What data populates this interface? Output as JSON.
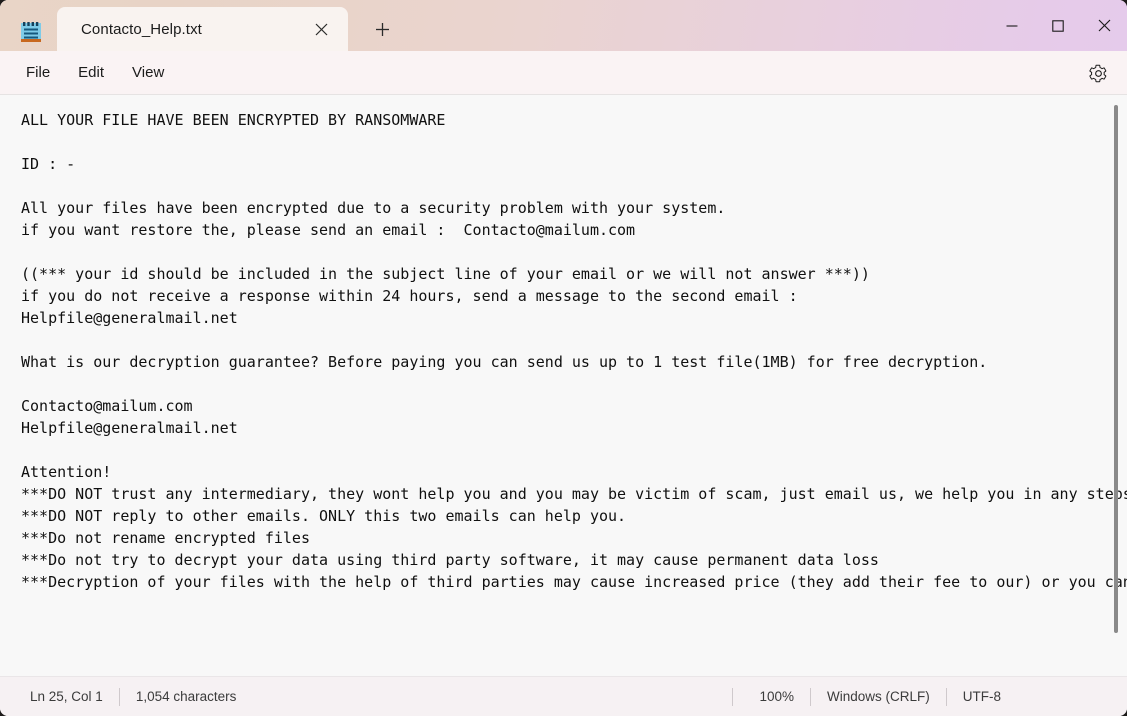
{
  "window": {
    "app_icon": "notepad-icon",
    "titlebar_gradient_start": "#e9d5c7",
    "titlebar_gradient_end": "#e5cbeb"
  },
  "tabs": [
    {
      "label": "Contacto_Help.txt",
      "close_icon": "close-icon",
      "active": true
    }
  ],
  "newtab": {
    "icon": "plus-icon",
    "label": "+"
  },
  "window_controls": [
    {
      "name": "minimize",
      "icon": "minimize-icon"
    },
    {
      "name": "maximize",
      "icon": "maximize-icon"
    },
    {
      "name": "close",
      "icon": "close-icon"
    }
  ],
  "menubar": {
    "items": [
      {
        "label": "File"
      },
      {
        "label": "Edit"
      },
      {
        "label": "View"
      }
    ],
    "settings": {
      "icon": "gear-icon",
      "label": "Settings"
    }
  },
  "editor": {
    "content": "ALL YOUR FILE HAVE BEEN ENCRYPTED BY RANSOMWARE\n\nID : -\n\nAll your files have been encrypted due to a security problem with your system.\nif you want restore the, please send an email :  Contacto@mailum.com\n\n((*** your id should be included in the subject line of your email or we will not answer ***))\nif you do not receive a response within 24 hours, send a message to the second email :\nHelpfile@generalmail.net\n\nWhat is our decryption guarantee? Before paying you can send us up to 1 test file(1MB) for free decryption.\n\nContacto@mailum.com\nHelpfile@generalmail.net\n\nAttention!\n***DO NOT trust any intermediary, they wont help you and you may be victim of scam, just email us, we help you in any steps\n***DO NOT reply to other emails. ONLY this two emails can help you.\n***Do not rename encrypted files\n***Do not try to decrypt your data using third party software, it may cause permanent data loss\n***Decryption of your files with the help of third parties may cause increased price (they add their fee to our) or you can become a victim of a scam\n"
  },
  "statusbar": {
    "position": "Ln 25, Col 1",
    "characters": "1,054 characters",
    "zoom": "100%",
    "line_ending": "Windows (CRLF)",
    "encoding": "UTF-8"
  }
}
